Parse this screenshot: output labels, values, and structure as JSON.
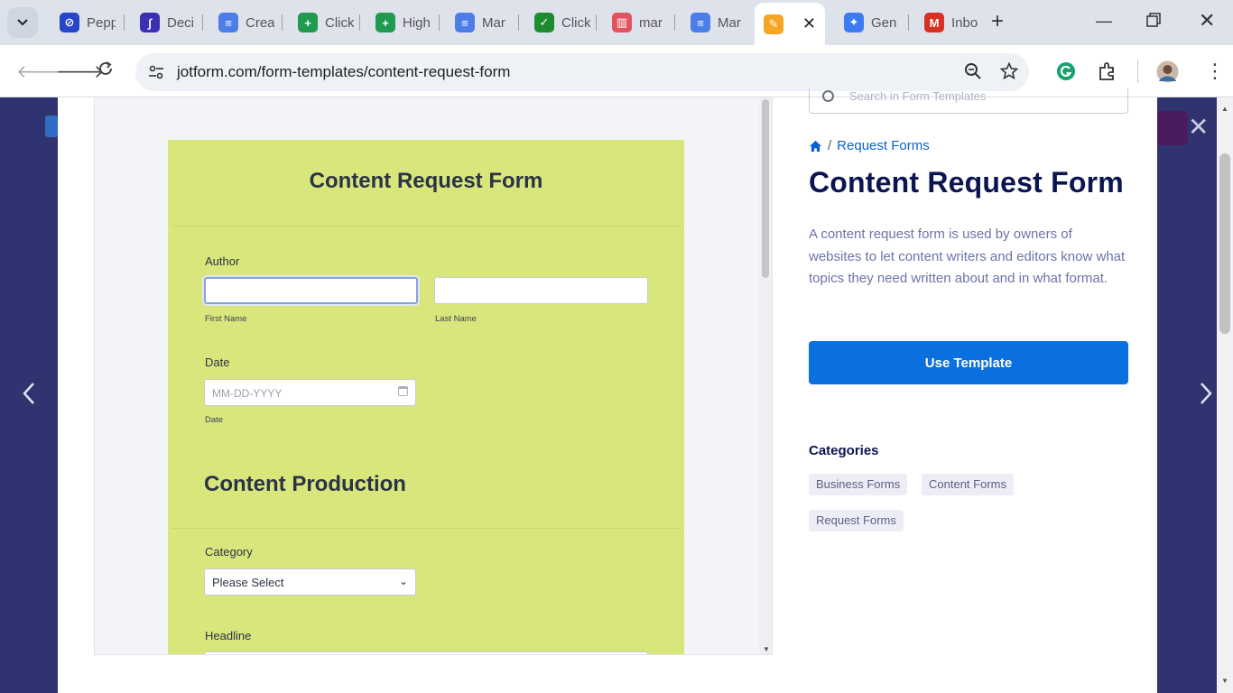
{
  "browser": {
    "tabs": [
      {
        "title": "Pepp",
        "color": "#2546c9",
        "glyph": "⊘"
      },
      {
        "title": "Deci",
        "color": "#3b2fb3",
        "glyph": "∫"
      },
      {
        "title": "Crea",
        "color": "#4c7ee8",
        "glyph": "≡"
      },
      {
        "title": "Click",
        "color": "#1f9a4f",
        "glyph": "+"
      },
      {
        "title": "High",
        "color": "#1f9a4f",
        "glyph": "+"
      },
      {
        "title": "Mar",
        "color": "#4c7ee8",
        "glyph": "≡"
      },
      {
        "title": "Click",
        "color": "#1c8c2f",
        "glyph": "✓"
      },
      {
        "title": "mar",
        "color": "#e0535f",
        "glyph": "▥"
      },
      {
        "title": "Mar",
        "color": "#4c7ee8",
        "glyph": "≡"
      },
      {
        "title": "",
        "color": "#f5a623",
        "glyph": "✎"
      },
      {
        "title": "Gen",
        "color": "#3d7bf0",
        "glyph": "✦"
      },
      {
        "title": "Inbo",
        "color": "#d93025",
        "glyph": "M"
      }
    ],
    "url": "jotform.com/form-templates/content-request-form"
  },
  "form": {
    "title": "Content Request Form",
    "author_label": "Author",
    "first_name_sublabel": "First Name",
    "last_name_sublabel": "Last Name",
    "date_label": "Date",
    "date_placeholder": "MM-DD-YYYY",
    "date_sublabel": "Date",
    "section_title": "Content Production",
    "category_label": "Category",
    "category_value": "Please Select",
    "headline_label": "Headline"
  },
  "panel": {
    "search_placeholder": "Search in Form Templates",
    "breadcrumb": "Request Forms",
    "title": "Content Request Form",
    "description": "A content request form is used by owners of websites to let content writers and editors know what topics they need written about and in what format.",
    "use_button": "Use Template",
    "categories_heading": "Categories",
    "categories": [
      "Business Forms",
      "Content Forms",
      "Request Forms"
    ]
  }
}
